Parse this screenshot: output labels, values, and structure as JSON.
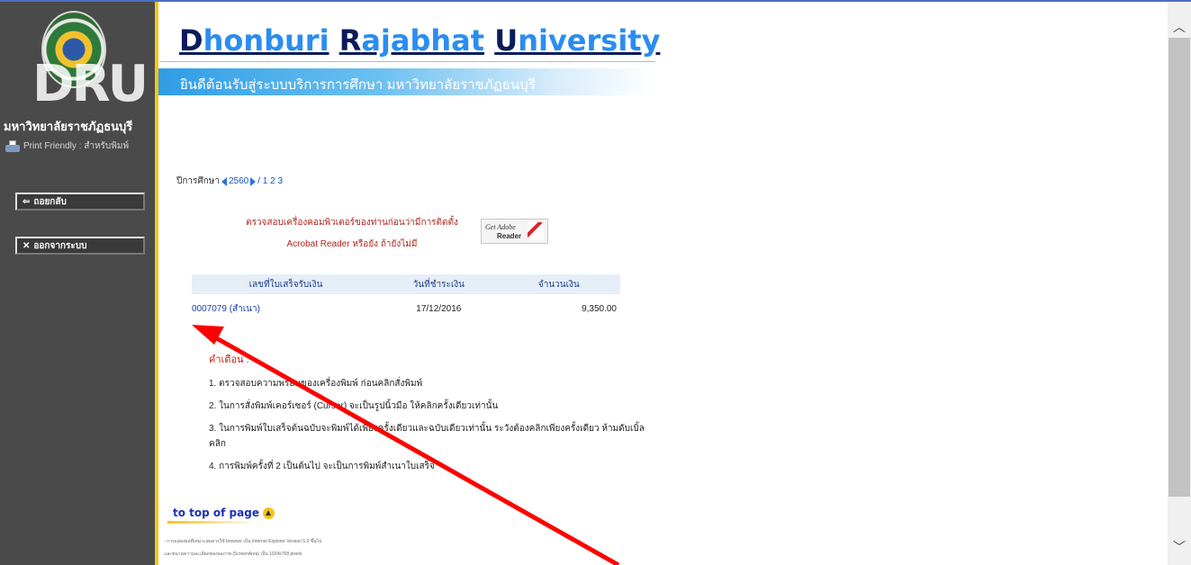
{
  "sidebar": {
    "logo_text": "DRU",
    "university_thai": "มหาวิทยาลัยราชภัฏธนบุรี",
    "print_friendly": "Print Friendly : สำหรับพิมพ์",
    "back_button": "ถอยกลับ",
    "logout_button": "ออกจากระบบ"
  },
  "header": {
    "title_d": "D",
    "title_honburi": "honburi",
    "title_r": "R",
    "title_ajabhat": "ajabhat",
    "title_u": "U",
    "title_niversity": "niversity",
    "banner": "ยินดีต้อนรับสู่ระบบบริการการศึกษา มหาวิทยาลัยราชภัฏธนบุรี"
  },
  "year": {
    "label": "ปีการศึกษา",
    "value": "2560",
    "pages": "/ 1 2 3"
  },
  "acrobat": {
    "notice_line1": "ตรวจสอบเครื่องคอมพิวเตอร์ของท่านก่อนว่ามีการติดตั้ง",
    "notice_line2": "Acrobat Reader หรือยัง ถ้ายังไม่มี",
    "badge_get": "Get Adobe",
    "badge_reader": "Reader"
  },
  "table": {
    "headers": [
      "เลขที่ใบเสร็จรับเงิน",
      "วันที่ชำระเงิน",
      "จำนวนเงิน"
    ],
    "rows": [
      {
        "receipt": "0007079 (สำเนา)",
        "date": "17/12/2016",
        "amount": "9,350.00"
      }
    ]
  },
  "warning": {
    "title": "คำเตือน :",
    "items": [
      "1. ตรวจสอบความพร้อมของเครื่องพิมพ์ ก่อนคลิกสั่งพิมพ์",
      "2. ในการสั่งพิมพ์เคอร์เซอร์ (Cursor) จะเป็นรูปนิ้วมือ ให้คลิกครั้งเดียวเท่านั้น",
      "3. ในการพิมพ์ใบเสร็จต้นฉบับจะพิมพ์ได้เพียงครั้งเดียวและฉบับเดียวเท่านั้น ระวังต้องคลิกเพียงครั้งเดียว ห้ามดับเบิ้ลคลิก",
      "4. การพิมพ์ครั้งที่ 2 เป็นต้นไป จะเป็นการพิมพ์สำเนาใบเสร็จ"
    ]
  },
  "footer": {
    "top_of_page": "to top of page",
    "note1": "- การแสดงผลที่เหมาะสมควรใช้ browser เป็น Internet Explorer Version 5.0 ขึ้นไป",
    "note2": "และขนาดความละเอียดของจอภาพ (ScreenArea) เป็น 1024x768 pixels"
  },
  "colors": {
    "sidebar": "#4a4a4a",
    "sidebar_edge": "#f7c51a",
    "title_dark": "#0b1b5a",
    "title_light": "#2a8df0",
    "banner": "#2f9de6",
    "link": "#1a3fae",
    "warning": "#c9201a",
    "annotation_arrow": "#ff0000"
  },
  "icons": [
    "printer-icon",
    "back-arrow-icon",
    "close-icon",
    "triangle-left-icon",
    "triangle-right-icon",
    "adobe-reader-icon",
    "up-arrow-circle-icon",
    "chevron-up-icon",
    "chevron-down-icon",
    "annotation-arrow"
  ]
}
